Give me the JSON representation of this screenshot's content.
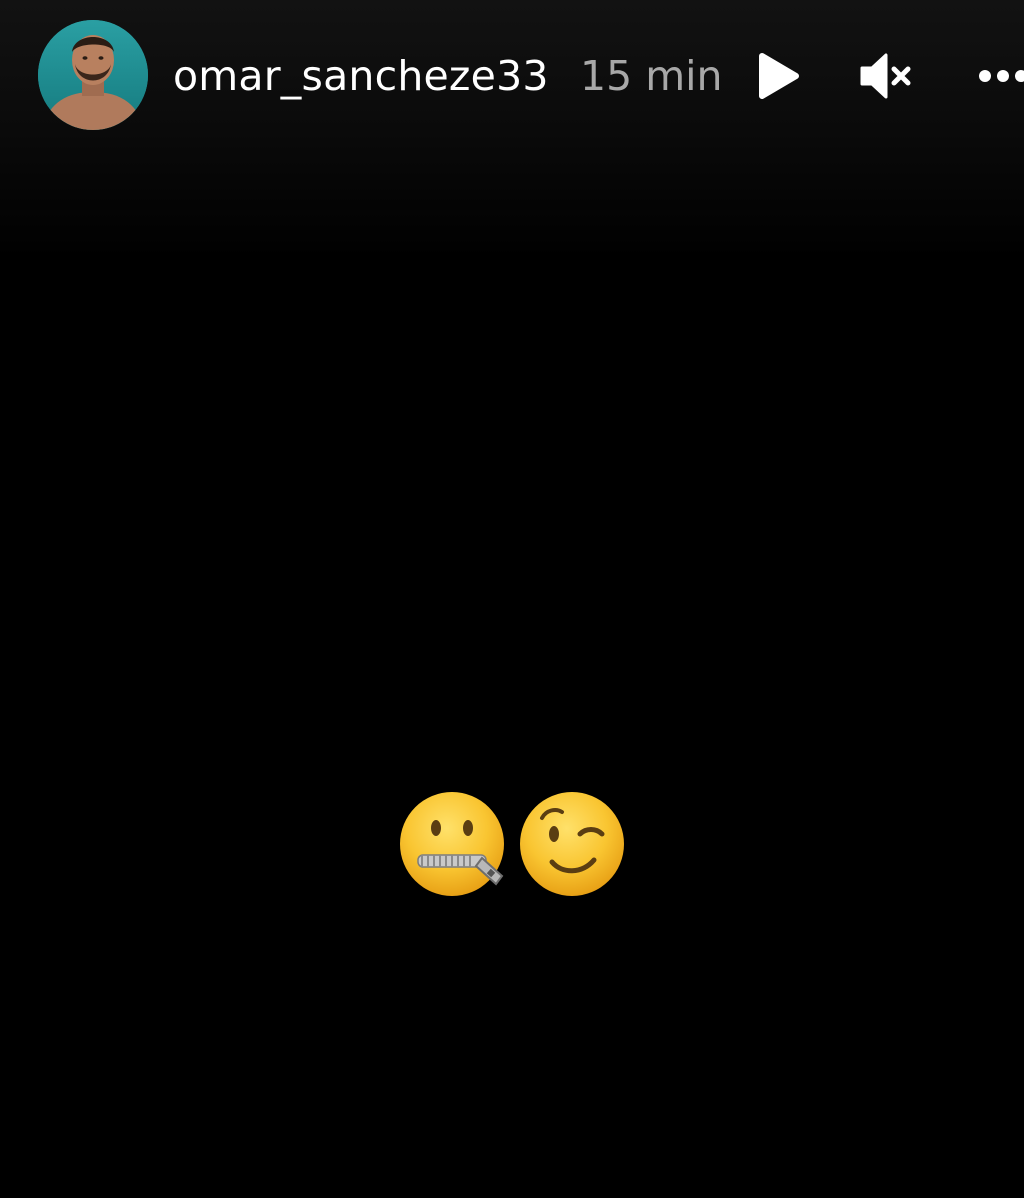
{
  "story": {
    "username": "omar_sancheze33",
    "time_ago": "15 min"
  },
  "controls": {
    "play_icon": "play-icon",
    "mute_icon": "volume-muted-icon",
    "more_icon": "more-options-icon"
  },
  "content": {
    "emojis": [
      "zipper-mouth-face",
      "winking-face"
    ]
  },
  "colors": {
    "background": "#000000",
    "username": "#ffffff",
    "time": "#a8a8a8",
    "avatar_bg": "#1f8f93",
    "emoji_yellow": "#f7c52b"
  }
}
